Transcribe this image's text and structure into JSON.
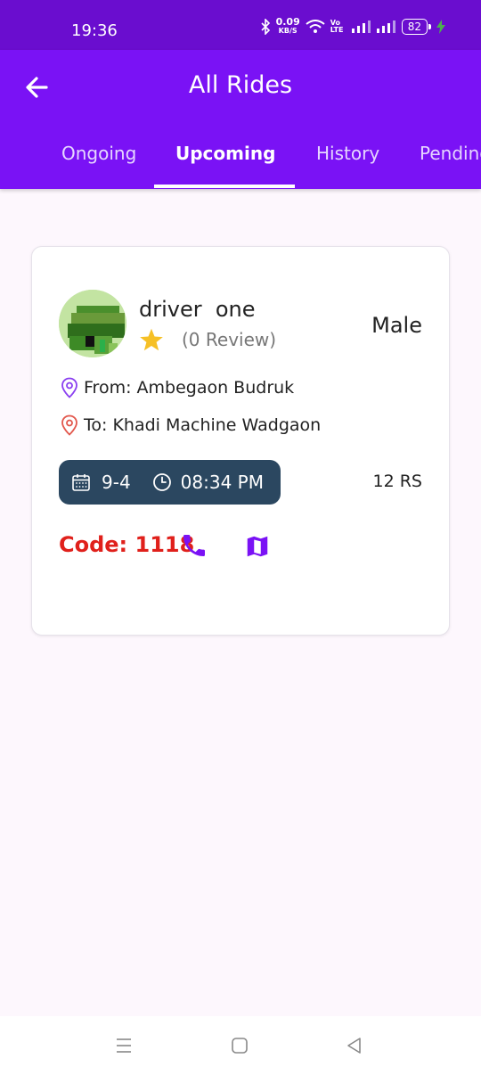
{
  "status_bar": {
    "time": "19:36",
    "speed_value": "0.09",
    "speed_unit": "KB/S",
    "network_label": "Vo LTE",
    "battery": "82"
  },
  "appbar": {
    "title": "All Rides",
    "tabs": [
      {
        "label": "Ongoing",
        "active": false
      },
      {
        "label": "Upcoming",
        "active": true
      },
      {
        "label": "History",
        "active": false
      },
      {
        "label": "Pending",
        "active": false
      }
    ]
  },
  "ride": {
    "driver_name": "driver  one",
    "reviews": "(0 Review)",
    "gender": "Male",
    "from": "From: Ambegaon Budruk",
    "to": "To: Khadi Machine Wadgaon",
    "date": "9-4",
    "time": "08:34 PM",
    "price": "12 RS",
    "code": "Code: 1118"
  },
  "icons": {
    "back": "arrow-left-icon",
    "star": "star-icon",
    "from": "location-pin-icon",
    "to": "location-pin-icon",
    "calendar": "calendar-icon",
    "clock": "clock-icon",
    "phone": "phone-icon",
    "map": "map-icon"
  },
  "colors": {
    "statusbar": "#6a0dcf",
    "appbar": "#7a12f5",
    "pill": "#2b4760",
    "code": "#e0201b",
    "accent": "#7a12f5",
    "star": "#f6c026",
    "to_pin": "#e2574c"
  }
}
